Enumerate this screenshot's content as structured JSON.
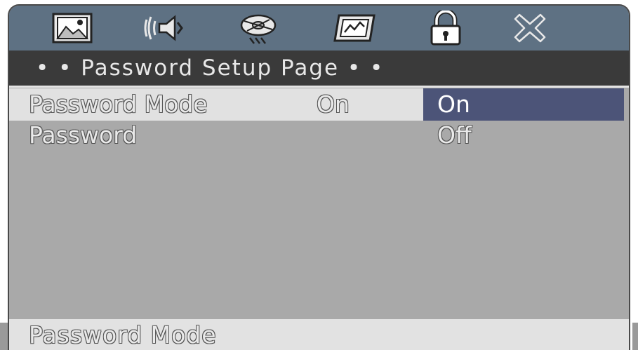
{
  "colors": {
    "tab_bar": "#5e7183",
    "title_bar": "#3a3a3a",
    "panel": "#a9a9a9",
    "selected_row": "#e1e1e1",
    "selected_option": "#4c5478"
  },
  "tabs": [
    {
      "icon": "picture-icon",
      "active": false
    },
    {
      "icon": "speaker-icon",
      "active": false
    },
    {
      "icon": "disc-icon",
      "active": false
    },
    {
      "icon": "preference-icon",
      "active": false
    },
    {
      "icon": "lock-icon",
      "active": true
    },
    {
      "icon": "exit-icon",
      "active": false
    }
  ],
  "page": {
    "title": "• •  Password Setup Page  • •"
  },
  "settings": [
    {
      "label": "Password Mode",
      "value": "On"
    },
    {
      "label": "Password",
      "value": ""
    }
  ],
  "options": [
    "On",
    "Off"
  ],
  "selected_option": "On",
  "status": {
    "text": "Password Mode"
  }
}
